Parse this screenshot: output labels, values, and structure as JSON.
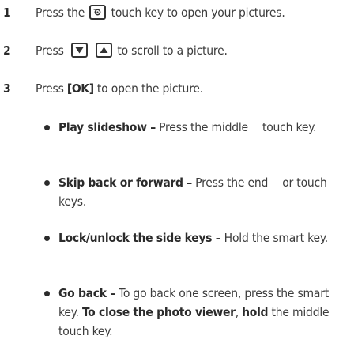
{
  "steps": [
    {
      "number": "1",
      "text_before": "Press the",
      "icon": "gallery-key-icon",
      "text_after": "touch key to open your pictures."
    },
    {
      "number": "2",
      "text_before": "Press",
      "icon_down": "down-arrow-key-icon",
      "icon_up": "up-arrow-key-icon",
      "text_after": "to scroll to a picture."
    },
    {
      "number": "3",
      "text_before": "Press",
      "key": "[OK]",
      "text_after": "to open the picture."
    }
  ],
  "bullets": [
    {
      "title": "Play slideshow –",
      "text_1": "Press the middle",
      "text_2": "touch key."
    },
    {
      "title": "Skip back or forward –",
      "text_1": "Press the end",
      "text_2": "or touch keys."
    },
    {
      "title": "Lock/unlock the side keys –",
      "text_1": "Hold the smart key."
    },
    {
      "title": "Go back –",
      "text_1": "To go back one screen, press the smart key.",
      "bold_1": "To close the photo viewer",
      "comma": ",",
      "bold_2": "hold",
      "text_2": "the middle touch key."
    }
  ],
  "colors": {
    "text": "#3c3c3c",
    "bold_text": "#2b2b2b",
    "background": "#ffffff"
  }
}
